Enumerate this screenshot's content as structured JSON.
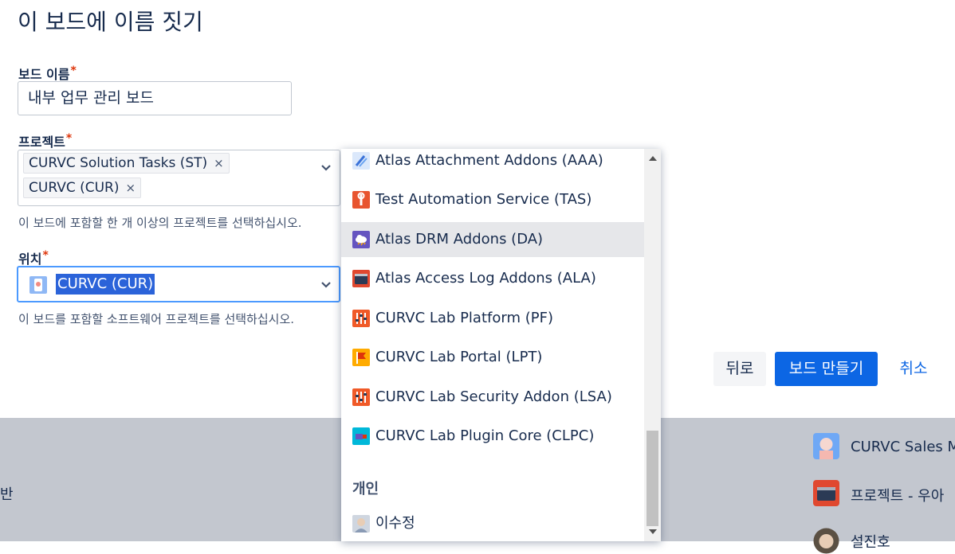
{
  "page": {
    "title": "이 보드에 이름 짓기"
  },
  "board_name": {
    "label": "보드 이름",
    "required": "*",
    "value": "내부 업무 관리 보드"
  },
  "projects": {
    "label": "프로젝트",
    "required": "*",
    "chips": [
      {
        "label": "CURVC Solution Tasks (ST)",
        "remove": "×"
      },
      {
        "label": "CURVC (CUR)",
        "remove": "×"
      }
    ],
    "helper": "이 보드에 포함할 한 개 이상의 프로젝트를 선택하십시오."
  },
  "location": {
    "label": "위치",
    "required": "*",
    "value": "CURVC (CUR)",
    "helper": "이 보드를 포함할 소프트웨어 프로젝트를 선택하십시오."
  },
  "buttons": {
    "back": "뒤로",
    "create": "보드 만들기",
    "cancel": "취소"
  },
  "dropdown": {
    "options": [
      {
        "label": "Atlas Attachment Addons (AAA)",
        "icon": "paperclip-icon",
        "color": "#3b73d9"
      },
      {
        "label": "Test Automation Service (TAS)",
        "icon": "wrench-icon",
        "color": "#e8542f"
      },
      {
        "label": "Atlas DRM Addons (DA)",
        "icon": "cloud-icon",
        "color": "#6554c0"
      },
      {
        "label": "Atlas Access Log Addons (ALA)",
        "icon": "browser-window-icon",
        "color": "#e0482f"
      },
      {
        "label": "CURVC Lab Platform (PF)",
        "icon": "sliders-icon",
        "color": "#f05a28"
      },
      {
        "label": "CURVC Lab Portal (LPT)",
        "icon": "flag-icon",
        "color": "#ffab00"
      },
      {
        "label": "CURVC Lab Security Addon (LSA)",
        "icon": "sliders-icon",
        "color": "#f05a28"
      },
      {
        "label": "CURVC Lab Plugin Core (CLPC)",
        "icon": "plugin-icon",
        "color": "#00b8d9"
      }
    ],
    "group_label": "개인",
    "personal": [
      {
        "label": "이수정",
        "icon": "user-avatar-icon"
      }
    ]
  },
  "footer": {
    "left_text": "반",
    "right_items": [
      {
        "label": "CURVC Sales M",
        "icon": "avatar-icon"
      },
      {
        "label": "프로젝트 - 우아",
        "icon": "project-icon"
      },
      {
        "label": "설진호",
        "icon": "avatar-icon"
      }
    ]
  }
}
